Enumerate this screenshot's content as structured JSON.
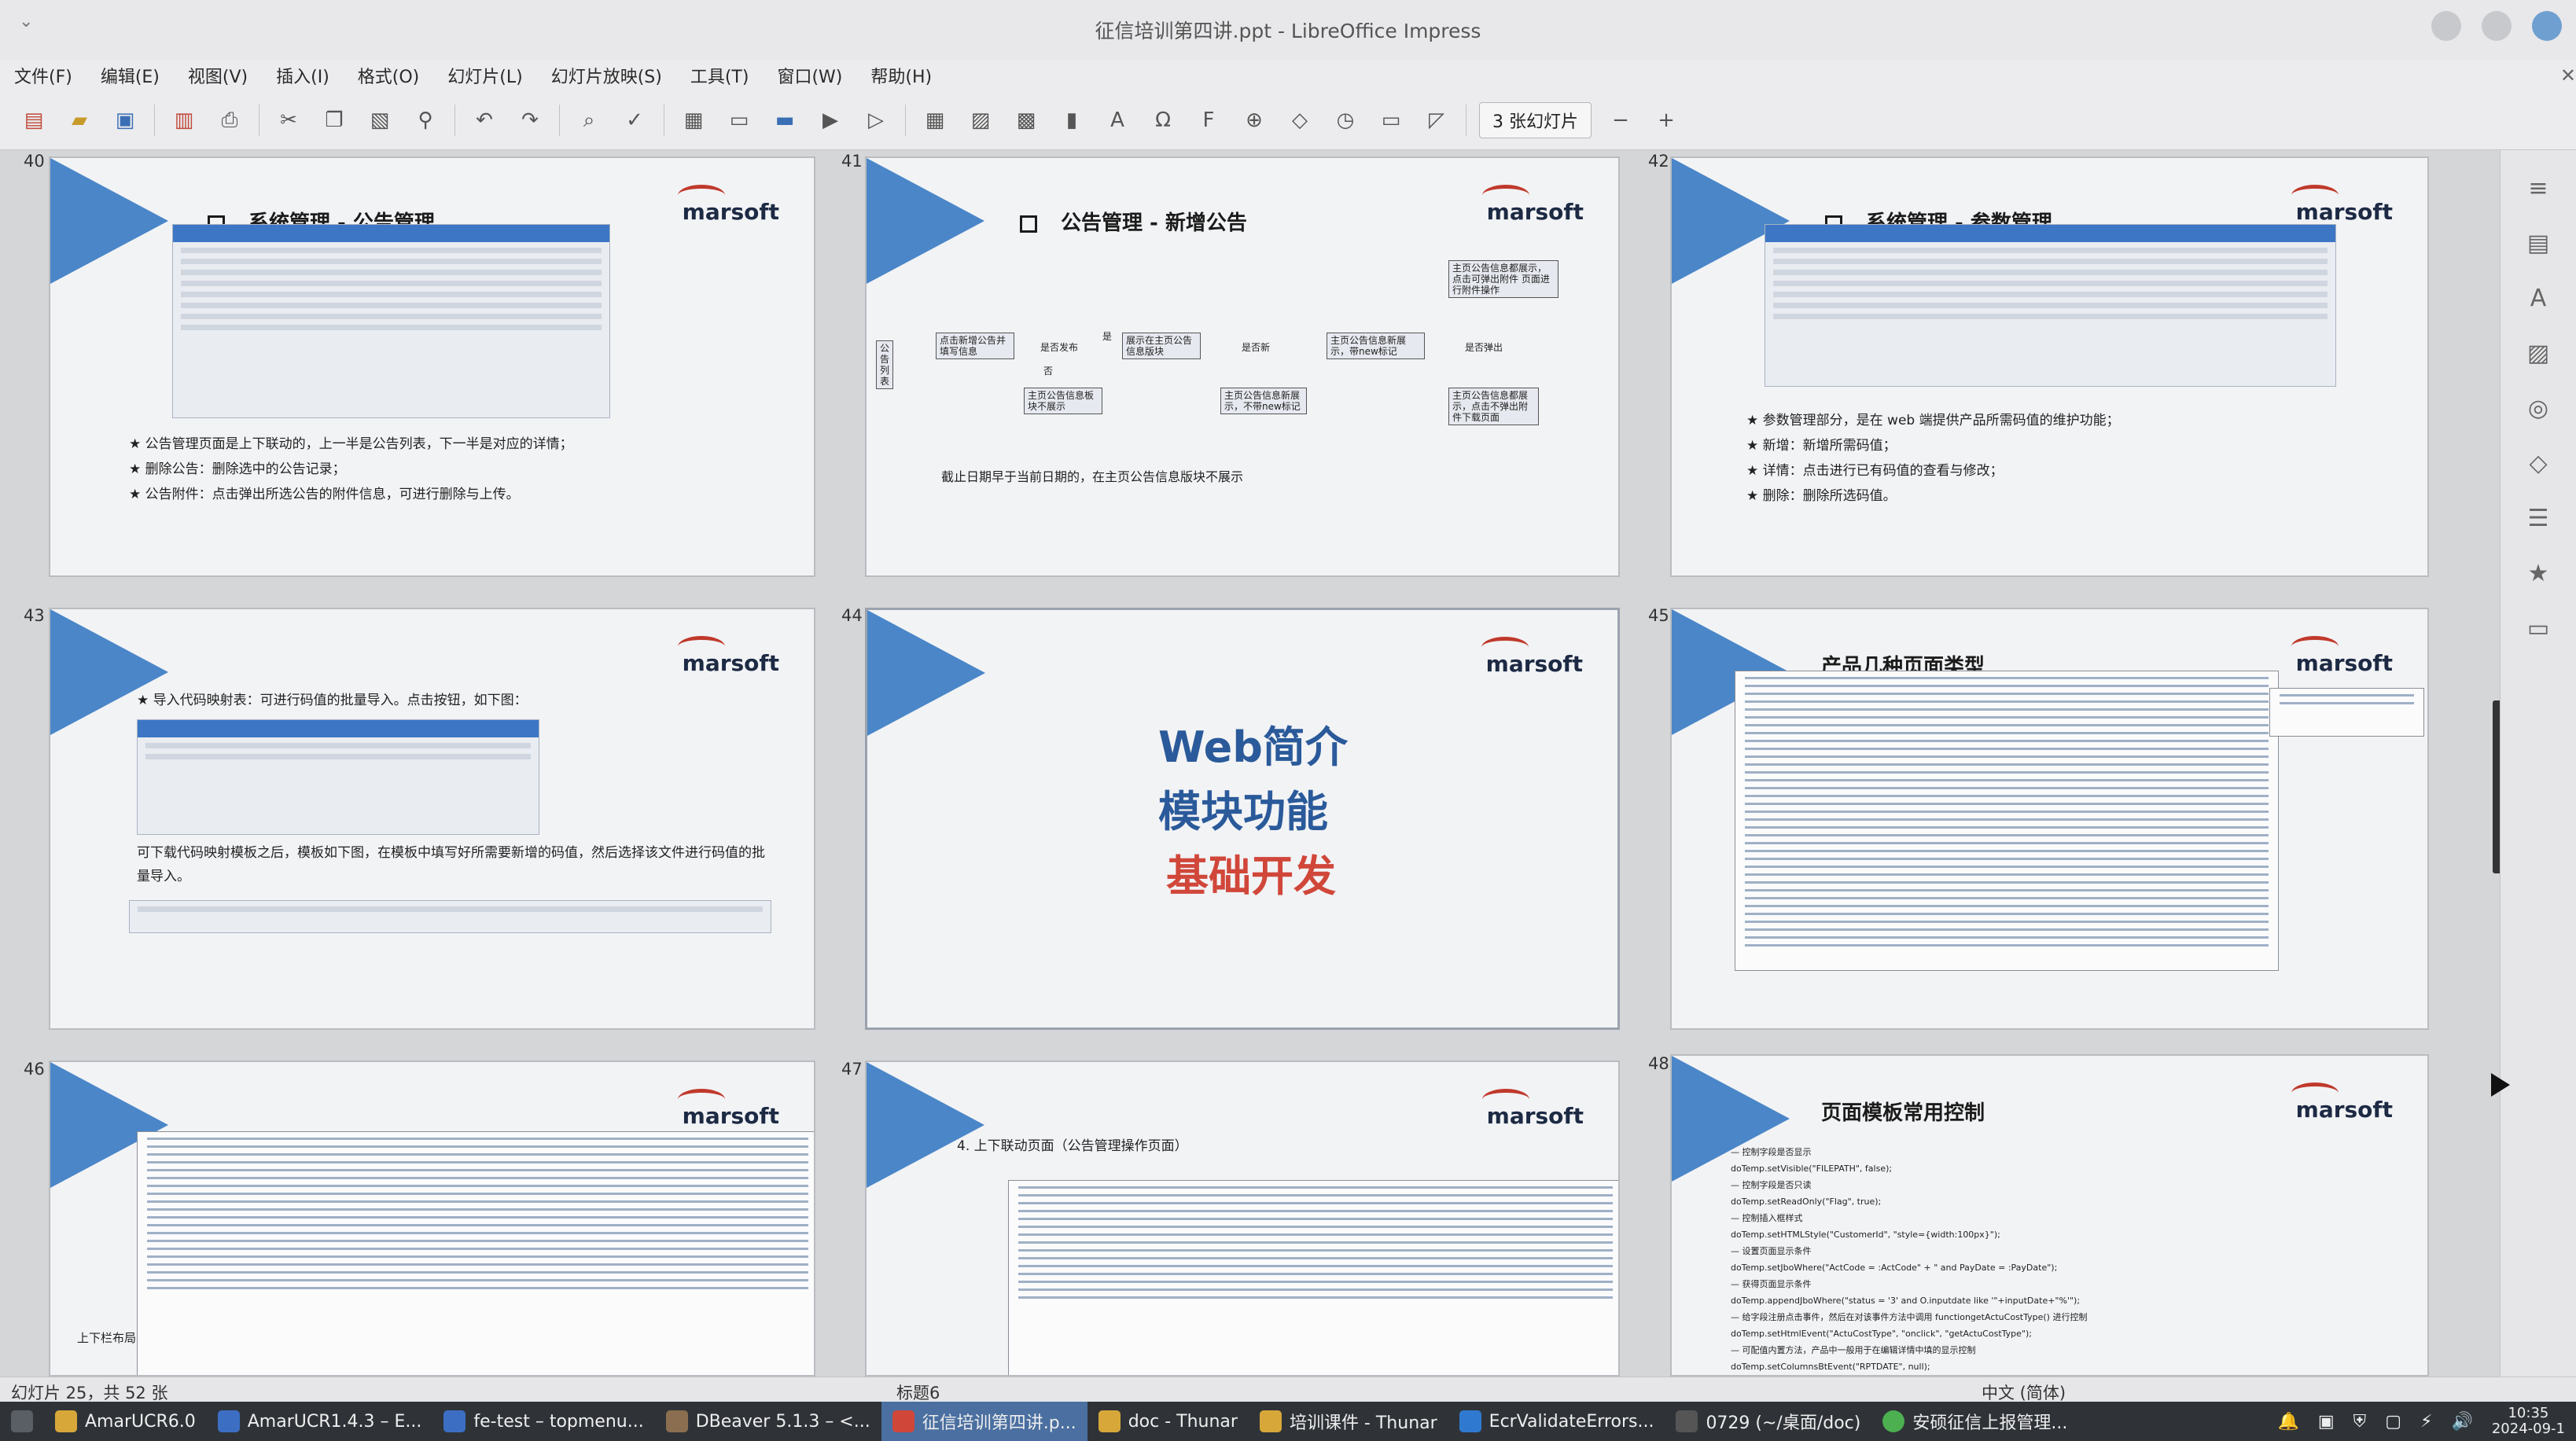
{
  "window": {
    "title": "征信培训第四讲.ppt - LibreOffice Impress"
  },
  "menu": [
    "文件(F)",
    "编辑(E)",
    "视图(V)",
    "插入(I)",
    "格式(O)",
    "幻灯片(L)",
    "幻灯片放映(S)",
    "工具(T)",
    "窗口(W)",
    "帮助(H)"
  ],
  "toolbar": {
    "icons": [
      "new-icon",
      "open-icon",
      "save-icon",
      "export-pdf-icon",
      "print-icon",
      "cut-icon",
      "copy-icon",
      "paste-icon",
      "clone-format-icon",
      "undo-icon",
      "redo-icon",
      "find-icon",
      "spellcheck-icon",
      "grid-icon",
      "layout-icon",
      "display-icon",
      "start-slideshow-icon",
      "start-current-icon",
      "table-icon",
      "image-icon",
      "media-icon",
      "chart-icon",
      "textbox-icon",
      "special-char-icon",
      "fontwork-icon",
      "hyperlink-icon",
      "shapes-icon",
      "transform-icon",
      "master-icon",
      "aspect-icon"
    ],
    "slides_per_row": "3 张幻灯片",
    "zoom_out": "−",
    "zoom_in": "+"
  },
  "slides": [
    {
      "num": "40",
      "title": "系统管理 - 公告管理",
      "bullets": [
        "★ 公告管理页面是上下联动的，上一半是公告列表，下一半是对应的详情；",
        "★ 删除公告：删除选中的公告记录；",
        "★ 公告附件：点击弹出所选公告的附件信息，可进行删除与上传。"
      ]
    },
    {
      "num": "41",
      "title": "公告管理 - 新增公告",
      "flow": {
        "start": "公告列表",
        "n1": "点击新增公告并填写信息",
        "d1": "是否发布",
        "n2": "展示在主页公告信息版块",
        "d2": "是否新",
        "n3": "主页公告信息新展示，带new标记",
        "d3": "是否弹出",
        "n4": "主页公告信息都展示，点击可弹出附件 页面进行附件操作",
        "n5": "主页公告信息板块不展示",
        "n6": "主页公告信息新展示，不带new标记",
        "n7": "主页公告信息都展示，点击不弹出附件下载页面",
        "yes": "是",
        "no": "否"
      },
      "note": "截止日期早于当前日期的，在主页公告信息版块不展示"
    },
    {
      "num": "42",
      "title": "系统管理 - 参数管理",
      "bullets": [
        "★ 参数管理部分，是在 web 端提供产品所需码值的维护功能；",
        "★ 新增：新增所需码值；",
        "★ 详情：点击进行已有码值的查看与修改；",
        "★ 删除：删除所选码值。"
      ]
    },
    {
      "num": "43",
      "bullets": [
        "★ 导入代码映射表：可进行码值的批量导入。点击按钮，如下图："
      ],
      "text2": "可下载代码映射模板之后，模板如下图，在模板中填写好所需要新增的码值，然后选择该文件进行码值的批量导入。"
    },
    {
      "num": "44",
      "lines": [
        "Web简介",
        "模块功能",
        "基础开发"
      ]
    },
    {
      "num": "45",
      "title": "产品几种页面类型"
    },
    {
      "num": "46",
      "caption": "上下栏布局"
    },
    {
      "num": "47",
      "title": "4. 上下联动页面（公告管理操作页面）"
    },
    {
      "num": "48",
      "title": "页面模板常用控制",
      "items": [
        "— 控制字段是否显示",
        "doTemp.setVisible(\"FILEPATH\", false);",
        "— 控制字段是否只读",
        "doTemp.setReadOnly(\"Flag\", true);",
        "— 控制插入框样式",
        "doTemp.setHTMLStyle(\"CustomerId\", \"style={width:100px}\");",
        "— 设置页面显示条件",
        "doTemp.setJboWhere(\"ActCode = :ActCode\" + \" and PayDate = :PayDate\");",
        "— 获得页面显示条件",
        "doTemp.appendJboWhere(\"status = '3' and O.inputdate like '\"+inputDate+\"%'\");",
        "— 给字段注册点击事件，然后在对该事件方法中调用 functiongetActuCostType() 进行控制",
        "doTemp.setHtmlEvent(\"ActuCostType\", \"onclick\", \"getActuCostType\");",
        "— 可配值内置方法，产品中一般用于在编辑详情中填的显示控制",
        "doTemp.setColumnsBtEvent(\"RPTDATE\", null);"
      ]
    }
  ],
  "statusbar": {
    "slide_info": "幻灯片 25，共 52 张",
    "layout": "标题6",
    "lang": "中文 (简体)"
  },
  "taskbar": [
    "AmarUCR6.0",
    "AmarUCR1.4.3 – E...",
    "fe-test – topmenu...",
    "DBeaver 5.1.3 – <...",
    "征信培训第四讲.p...",
    "doc - Thunar",
    "培训课件 - Thunar",
    "EcrValidateErrors...",
    "0729 (~/桌面/doc)",
    "安硕征信上报管理..."
  ],
  "clock": {
    "time": "10:35",
    "date": "2024-09-1"
  },
  "colors": {
    "accent": "#4a86c8",
    "red_title": "#d0473a",
    "blue_title": "#2a5a9a",
    "active_task": "#4a6fa0"
  }
}
